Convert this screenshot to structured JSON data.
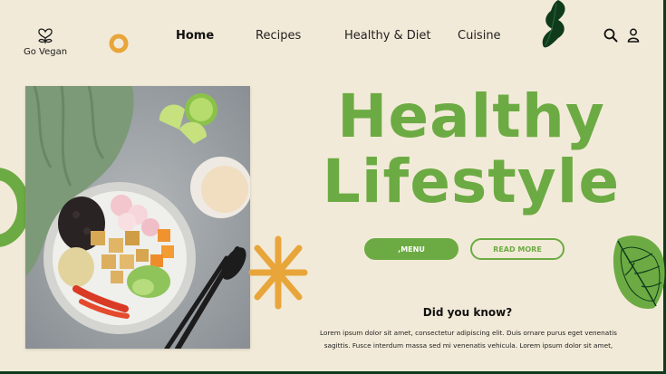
{
  "brand": {
    "name": "Go Vegan",
    "icon": "heart-leaf-icon"
  },
  "nav": {
    "items": [
      {
        "label": "Home",
        "active": true
      },
      {
        "label": "Recipes",
        "active": false
      },
      {
        "label": "Healthy & Diet",
        "active": false
      },
      {
        "label": "Cuisine",
        "active": false
      }
    ]
  },
  "header_icons": [
    "search-icon",
    "user-icon"
  ],
  "hero": {
    "title_line1": "Healthy",
    "title_line2": "Lifestyle",
    "menu_button": ",MENU",
    "read_more_button": "READ MORE"
  },
  "did_you_know": {
    "title": "Did you know?",
    "line1": "Lorem ipsum dolor sit amet, consectetur adipiscing elit. Duis ornare purus eget venenatis",
    "line2": "sagittis. Fusce interdum massa sed mi venenatis vehicula. Lorem ipsum dolor sit amet,"
  },
  "colors": {
    "background": "#f2ead8",
    "accent_green": "#6cab43",
    "dark_green": "#0f3b1c",
    "orange": "#e8a53a"
  }
}
